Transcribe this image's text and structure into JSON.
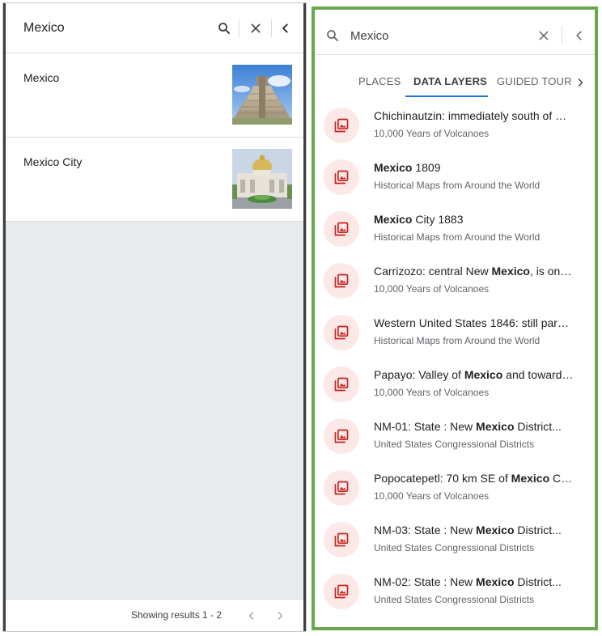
{
  "left_panel": {
    "search": {
      "query": "Mexico"
    },
    "results": [
      {
        "name": "Mexico",
        "thumbnail": "pyramid-photo"
      },
      {
        "name": "Mexico City",
        "thumbnail": "palace-photo"
      }
    ],
    "footer": {
      "count_text": "Showing results 1 - 2"
    }
  },
  "right_panel": {
    "search": {
      "query": "Mexico"
    },
    "tabs": [
      {
        "label": "PLACES",
        "active": false
      },
      {
        "label": "DATA LAYERS",
        "active": true
      },
      {
        "label": "GUIDED TOUR",
        "active": false
      }
    ],
    "layers": [
      {
        "title_pre": "Chichinautzin: immediately south of …",
        "title_bold": "",
        "title_post": "",
        "subtitle": "10,000 Years of Volcanoes"
      },
      {
        "title_pre": "",
        "title_bold": "Mexico",
        "title_post": " 1809",
        "subtitle": "Historical Maps from Around the World"
      },
      {
        "title_pre": "",
        "title_bold": "Mexico",
        "title_post": " City 1883",
        "subtitle": "Historical Maps from Around the World"
      },
      {
        "title_pre": "Carrizozo: central New ",
        "title_bold": "Mexico",
        "title_post": ", is on…",
        "subtitle": "10,000 Years of Volcanoes"
      },
      {
        "title_pre": "Western United States 1846: still par…",
        "title_bold": "",
        "title_post": "",
        "subtitle": "Historical Maps from Around the World"
      },
      {
        "title_pre": "Papayo: Valley of ",
        "title_bold": "Mexico",
        "title_post": " and toward…",
        "subtitle": "10,000 Years of Volcanoes"
      },
      {
        "title_pre": "NM-01: State : New ",
        "title_bold": "Mexico",
        "title_post": " District...",
        "subtitle": "United States Congressional Districts"
      },
      {
        "title_pre": "Popocatepetl: 70 km SE of ",
        "title_bold": "Mexico",
        "title_post": " C…",
        "subtitle": "10,000 Years of Volcanoes"
      },
      {
        "title_pre": "NM-03: State : New ",
        "title_bold": "Mexico",
        "title_post": " District...",
        "subtitle": "United States Congressional Districts"
      },
      {
        "title_pre": "NM-02: State : New ",
        "title_bold": "Mexico",
        "title_post": " District...",
        "subtitle": "United States Congressional Districts"
      }
    ]
  },
  "colors": {
    "accent_blue": "#1a73e8",
    "layer_icon_bg": "#fce8e6",
    "layer_icon_fg": "#c5221f",
    "highlight_border": "#6aa84f"
  },
  "icons": {
    "search": "search-icon",
    "clear": "close-icon",
    "collapse": "chevron-left-icon",
    "layer": "photo-library-icon",
    "pager_prev": "chevron-left-icon",
    "pager_next": "chevron-right-icon",
    "tabs_scroll": "chevron-right-icon"
  }
}
